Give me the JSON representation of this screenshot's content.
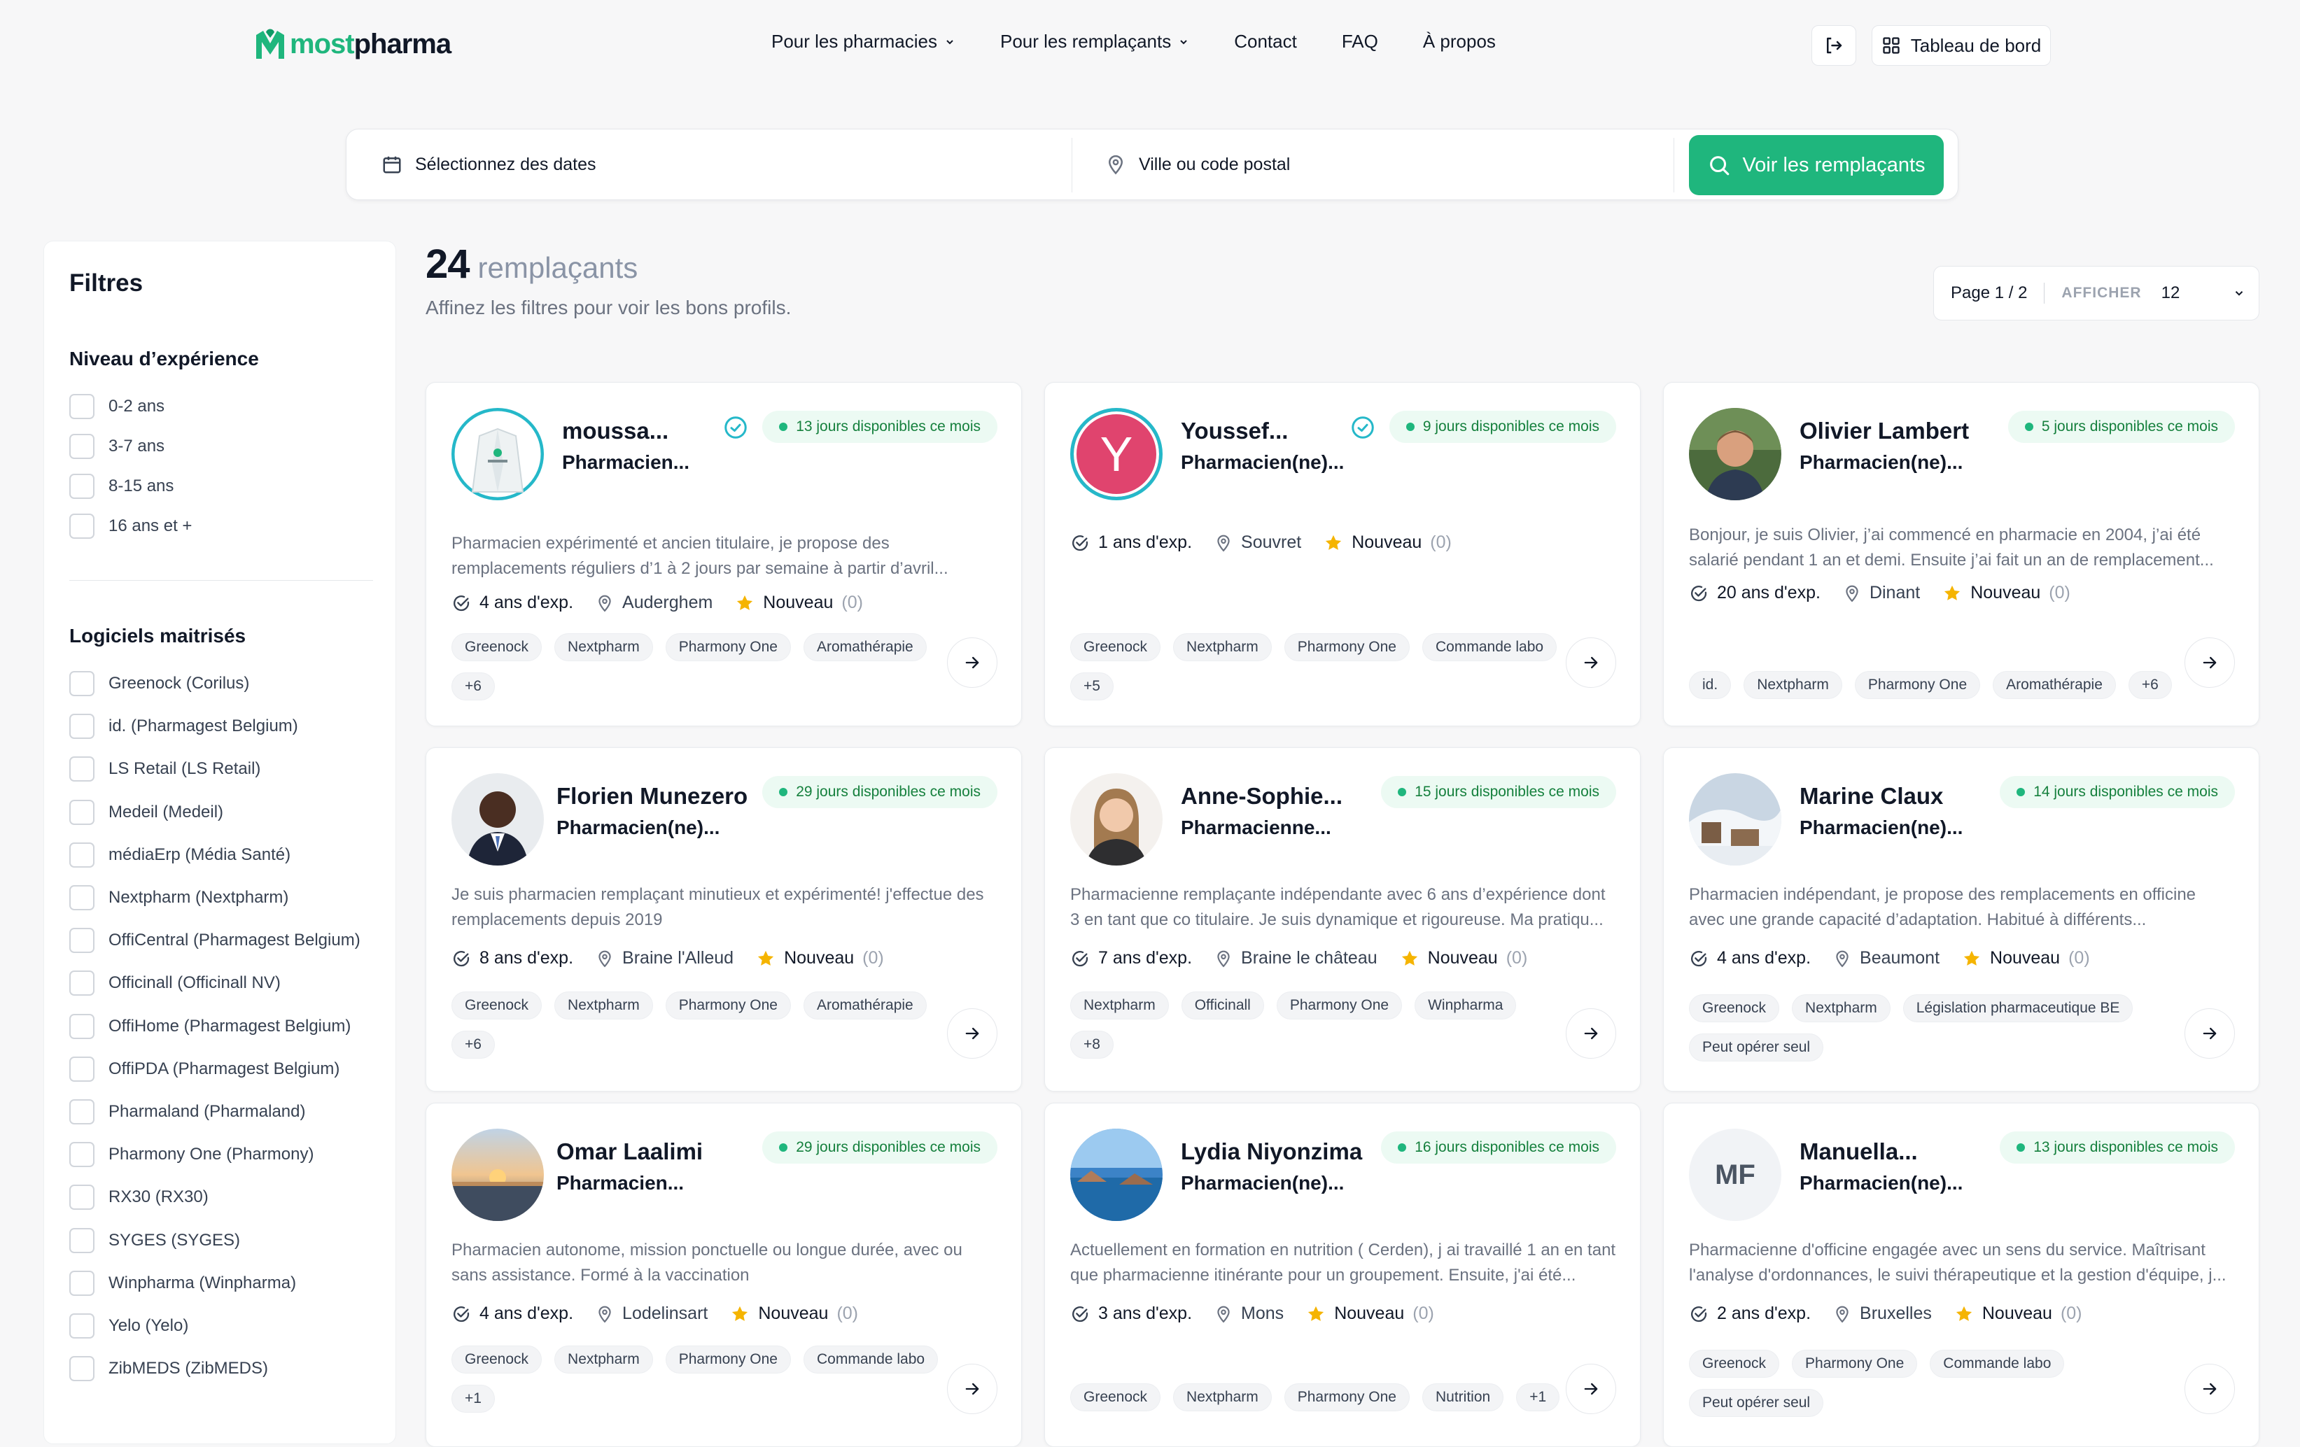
{
  "header": {
    "logo_part1": "most",
    "logo_part2": "pharma",
    "nav": [
      "Pour les pharmacies",
      "Pour les remplaçants",
      "Contact",
      "FAQ",
      "À propos"
    ],
    "dashboard_label": "Tableau de bord"
  },
  "search": {
    "dates_placeholder": "Sélectionnez des dates",
    "city_placeholder": "Ville ou code postal",
    "button_label": "Voir les remplaçants"
  },
  "sidebar": {
    "title": "Filtres",
    "experience_title": "Niveau d’expérience",
    "experience_options": [
      "0-2 ans",
      "3-7 ans",
      "8-15 ans",
      "16 ans et +"
    ],
    "software_title": "Logiciels maitrisés",
    "software_options": [
      "Greenock (Corilus)",
      "id. (Pharmagest Belgium)",
      "LS Retail (LS Retail)",
      "Medeil (Medeil)",
      "médiaErp (Média Santé)",
      "Nextpharm (Nextpharm)",
      "OffiCentral (Pharmagest Belgium)",
      "Officinall (Officinall NV)",
      "OffiHome (Pharmagest Belgium)",
      "OffiPDA (Pharmagest Belgium)",
      "Pharmaland (Pharmaland)",
      "Pharmony One (Pharmony)",
      "RX30 (RX30)",
      "SYGES (SYGES)",
      "Winpharma (Winpharma)",
      "Yelo (Yelo)",
      "ZibMEDS (ZibMEDS)"
    ]
  },
  "results": {
    "count": "24",
    "count_label": "remplaçants",
    "subtitle": "Affinez les filtres pour voir les bons profils.",
    "page": "Page 1 / 2",
    "show_label": "AFFICHER",
    "per_page": "12"
  },
  "cards": [
    {
      "name": "moussa...",
      "role": "Pharmacien...",
      "verified": true,
      "badge": "13 jours disponibles ce mois",
      "desc": "Pharmacien expérimenté et ancien titulaire, je propose des remplacements réguliers d’1 à 2 jours par semaine à partir d’avril...",
      "exp": "4 ans d'exp.",
      "loc": "Auderghem",
      "rating": "Nouveau",
      "reviews": "(0)",
      "tags": [
        "Greenock",
        "Nextpharm",
        "Pharmony One",
        "Aromathérapie",
        "+6"
      ]
    },
    {
      "name": "Youssef...",
      "role": "Pharmacien(ne)...",
      "verified": true,
      "initial": "Y",
      "badge": "9 jours disponibles ce mois",
      "desc": "",
      "exp": "1 ans d'exp.",
      "loc": "Souvret",
      "rating": "Nouveau",
      "reviews": "(0)",
      "tags": [
        "Greenock",
        "Nextpharm",
        "Pharmony One",
        "Commande labo",
        "+5"
      ]
    },
    {
      "name": "Olivier Lambert",
      "role": "Pharmacien(ne)...",
      "badge": "5 jours disponibles ce mois",
      "desc": "Bonjour, je suis Olivier, j’ai commencé en pharmacie en 2004, j’ai été salarié pendant 1 an et demi. Ensuite j’ai fait un an de remplacement...",
      "exp": "20 ans d'exp.",
      "loc": "Dinant",
      "rating": "Nouveau",
      "reviews": "(0)",
      "tags": [
        "id.",
        "Nextpharm",
        "Pharmony One",
        "Aromathérapie",
        "+6"
      ]
    },
    {
      "name": "Florien Munezero",
      "role": "Pharmacien(ne)...",
      "badge": "29 jours disponibles ce mois",
      "desc": "Je suis pharmacien remplaçant minutieux et expérimenté! j'effectue des remplacements depuis 2019",
      "exp": "8 ans d'exp.",
      "loc": "Braine l'Alleud",
      "rating": "Nouveau",
      "reviews": "(0)",
      "tags": [
        "Greenock",
        "Nextpharm",
        "Pharmony One",
        "Aromathérapie",
        "+6"
      ]
    },
    {
      "name": "Anne-Sophie...",
      "role": "Pharmacienne...",
      "badge": "15 jours disponibles ce mois",
      "desc": "Pharmacienne remplaçante indépendante avec 6 ans d’expérience dont 3 en tant que co titulaire. Je suis dynamique et rigoureuse. Ma pratiqu...",
      "exp": "7 ans d'exp.",
      "loc": "Braine le château",
      "rating": "Nouveau",
      "reviews": "(0)",
      "tags": [
        "Nextpharm",
        "Officinall",
        "Pharmony One",
        "Winpharma",
        "+8"
      ]
    },
    {
      "name": "Marine Claux",
      "role": "Pharmacien(ne)...",
      "badge": "14 jours disponibles ce mois",
      "desc": "Pharmacien indépendant, je propose des remplacements en officine avec une grande capacité d’adaptation. Habitué à différents...",
      "exp": "4 ans d'exp.",
      "loc": "Beaumont",
      "rating": "Nouveau",
      "reviews": "(0)",
      "tags": [
        "Greenock",
        "Nextpharm",
        "Législation pharmaceutique BE",
        "Peut opérer seul"
      ]
    },
    {
      "name": "Omar Laalimi",
      "role": "Pharmacien...",
      "badge": "29 jours disponibles ce mois",
      "desc": "Pharmacien autonome, mission ponctuelle ou longue durée, avec ou sans assistance. Formé à la vaccination",
      "exp": "4 ans d'exp.",
      "loc": "Lodelinsart",
      "rating": "Nouveau",
      "reviews": "(0)",
      "tags": [
        "Greenock",
        "Nextpharm",
        "Pharmony One",
        "Commande labo",
        "+1"
      ]
    },
    {
      "name": "Lydia Niyonzima",
      "role": "Pharmacien(ne)...",
      "badge": "16 jours disponibles ce mois",
      "desc": "Actuellement en formation en nutrition ( Cerden), j ai travaillé 1 an en tant que pharmacienne itinérante pour un groupement. Ensuite, j'ai été...",
      "exp": "3 ans d'exp.",
      "loc": "Mons",
      "rating": "Nouveau",
      "reviews": "(0)",
      "tags": [
        "Greenock",
        "Nextpharm",
        "Pharmony One",
        "Nutrition",
        "+1"
      ]
    },
    {
      "name": "Manuella...",
      "role": "Pharmacien(ne)...",
      "initial": "MF",
      "badge": "13 jours disponibles ce mois",
      "desc": "Pharmacienne d'officine engagée avec un sens du service. Maîtrisant l'analyse d'ordonnances, le suivi thérapeutique et la gestion d'équipe, j...",
      "exp": "2 ans d'exp.",
      "loc": "Bruxelles",
      "rating": "Nouveau",
      "reviews": "(0)",
      "tags": [
        "Greenock",
        "Pharmony One",
        "Commande labo",
        "Peut opérer seul"
      ]
    }
  ],
  "colors": {
    "accent": "#1fb67d",
    "star": "#f5b400",
    "avatar_pink": "#e0446e"
  }
}
